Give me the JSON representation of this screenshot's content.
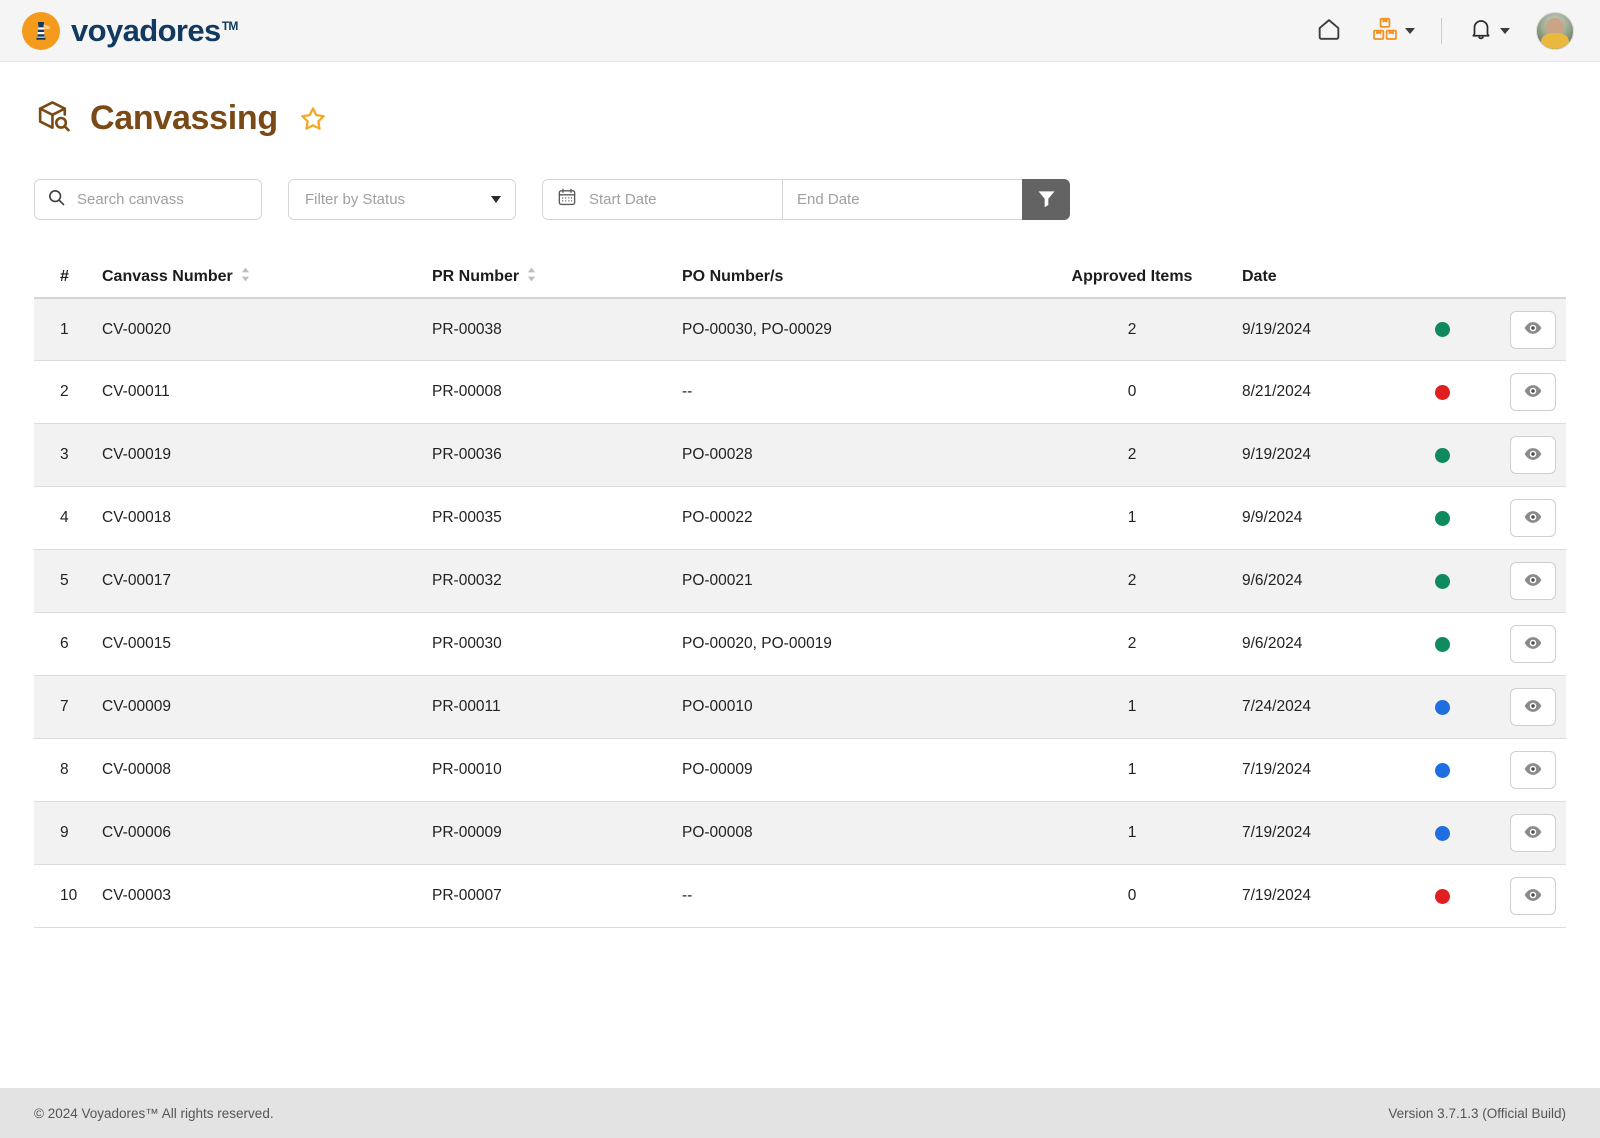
{
  "brand": {
    "name": "voyadores",
    "tm": "TM",
    "logo_icon": "lighthouse-icon",
    "accent_orange": "#f49b1e",
    "navy": "#12395f"
  },
  "topbar": {
    "home_icon": "home-icon",
    "inventory_icon": "boxes-icon",
    "notifications_icon": "bell-icon",
    "avatar_icon": "user-avatar",
    "inventory_caret": "chevron-down-icon",
    "notifications_caret": "chevron-down-icon"
  },
  "header": {
    "title": "Canvassing",
    "title_icon": "box-search-icon",
    "favorite_icon": "star-outline-icon",
    "title_color": "#7a4a16"
  },
  "filters": {
    "search_placeholder": "Search canvass",
    "search_value": "",
    "search_icon": "search-icon",
    "status_label": "Filter by Status",
    "status_caret": "chevron-down-icon",
    "calendar_icon": "calendar-icon",
    "start_date_placeholder": "Start Date",
    "start_date_value": "",
    "end_date_placeholder": "End Date",
    "end_date_value": "",
    "filter_button_icon": "funnel-icon"
  },
  "table": {
    "columns": [
      {
        "key": "index",
        "label": "#",
        "sortable": false
      },
      {
        "key": "canvass_number",
        "label": "Canvass Number",
        "sortable": true
      },
      {
        "key": "pr_number",
        "label": "PR Number",
        "sortable": true
      },
      {
        "key": "po_numbers",
        "label": "PO Number/s",
        "sortable": false
      },
      {
        "key": "approved_items",
        "label": "Approved Items",
        "sortable": false
      },
      {
        "key": "date",
        "label": "Date",
        "sortable": false
      }
    ],
    "sort_icon": "sort-updown-icon",
    "action_icon": "eye-icon",
    "status_colors": {
      "green": "#0f8a5c",
      "red": "#e02020",
      "blue": "#1f6fe0"
    },
    "rows": [
      {
        "index": "1",
        "canvass_number": "CV-00020",
        "pr_number": "PR-00038",
        "po_numbers": "PO-00030, PO-00029",
        "approved_items": "2",
        "date": "9/19/2024",
        "status": "green"
      },
      {
        "index": "2",
        "canvass_number": "CV-00011",
        "pr_number": "PR-00008",
        "po_numbers": "--",
        "approved_items": "0",
        "date": "8/21/2024",
        "status": "red"
      },
      {
        "index": "3",
        "canvass_number": "CV-00019",
        "pr_number": "PR-00036",
        "po_numbers": "PO-00028",
        "approved_items": "2",
        "date": "9/19/2024",
        "status": "green"
      },
      {
        "index": "4",
        "canvass_number": "CV-00018",
        "pr_number": "PR-00035",
        "po_numbers": "PO-00022",
        "approved_items": "1",
        "date": "9/9/2024",
        "status": "green"
      },
      {
        "index": "5",
        "canvass_number": "CV-00017",
        "pr_number": "PR-00032",
        "po_numbers": "PO-00021",
        "approved_items": "2",
        "date": "9/6/2024",
        "status": "green"
      },
      {
        "index": "6",
        "canvass_number": "CV-00015",
        "pr_number": "PR-00030",
        "po_numbers": "PO-00020, PO-00019",
        "approved_items": "2",
        "date": "9/6/2024",
        "status": "green"
      },
      {
        "index": "7",
        "canvass_number": "CV-00009",
        "pr_number": "PR-00011",
        "po_numbers": "PO-00010",
        "approved_items": "1",
        "date": "7/24/2024",
        "status": "blue"
      },
      {
        "index": "8",
        "canvass_number": "CV-00008",
        "pr_number": "PR-00010",
        "po_numbers": "PO-00009",
        "approved_items": "1",
        "date": "7/19/2024",
        "status": "blue"
      },
      {
        "index": "9",
        "canvass_number": "CV-00006",
        "pr_number": "PR-00009",
        "po_numbers": "PO-00008",
        "approved_items": "1",
        "date": "7/19/2024",
        "status": "blue"
      },
      {
        "index": "10",
        "canvass_number": "CV-00003",
        "pr_number": "PR-00007",
        "po_numbers": "--",
        "approved_items": "0",
        "date": "7/19/2024",
        "status": "red"
      }
    ]
  },
  "footer": {
    "copyright": "© 2024 Voyadores™ All rights reserved.",
    "version": "Version 3.7.1.3 (Official Build)"
  }
}
